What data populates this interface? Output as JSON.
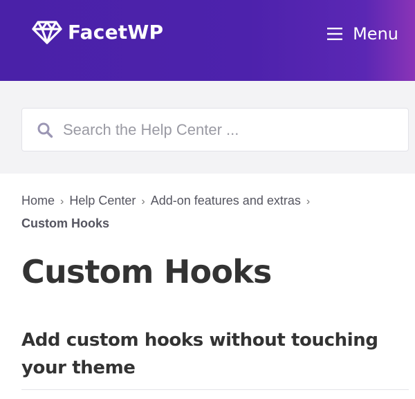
{
  "header": {
    "brand": "FacetWP",
    "menu_label": "Menu",
    "logo_icon": "diamond-logo-icon",
    "menu_icon": "hamburger-icon",
    "colors": {
      "background_start": "#4a21a8",
      "background_end": "#8a34b7",
      "text": "#ffffff"
    }
  },
  "search": {
    "placeholder": "Search the Help Center ...",
    "value": "",
    "icon": "search-icon",
    "icon_color": "#9b96b4"
  },
  "breadcrumb": {
    "items": [
      "Home",
      "Help Center",
      "Add-on features and extras"
    ],
    "current": "Custom Hooks"
  },
  "article": {
    "title": "Custom Hooks",
    "section_heading": "Add custom hooks without touching your theme"
  }
}
